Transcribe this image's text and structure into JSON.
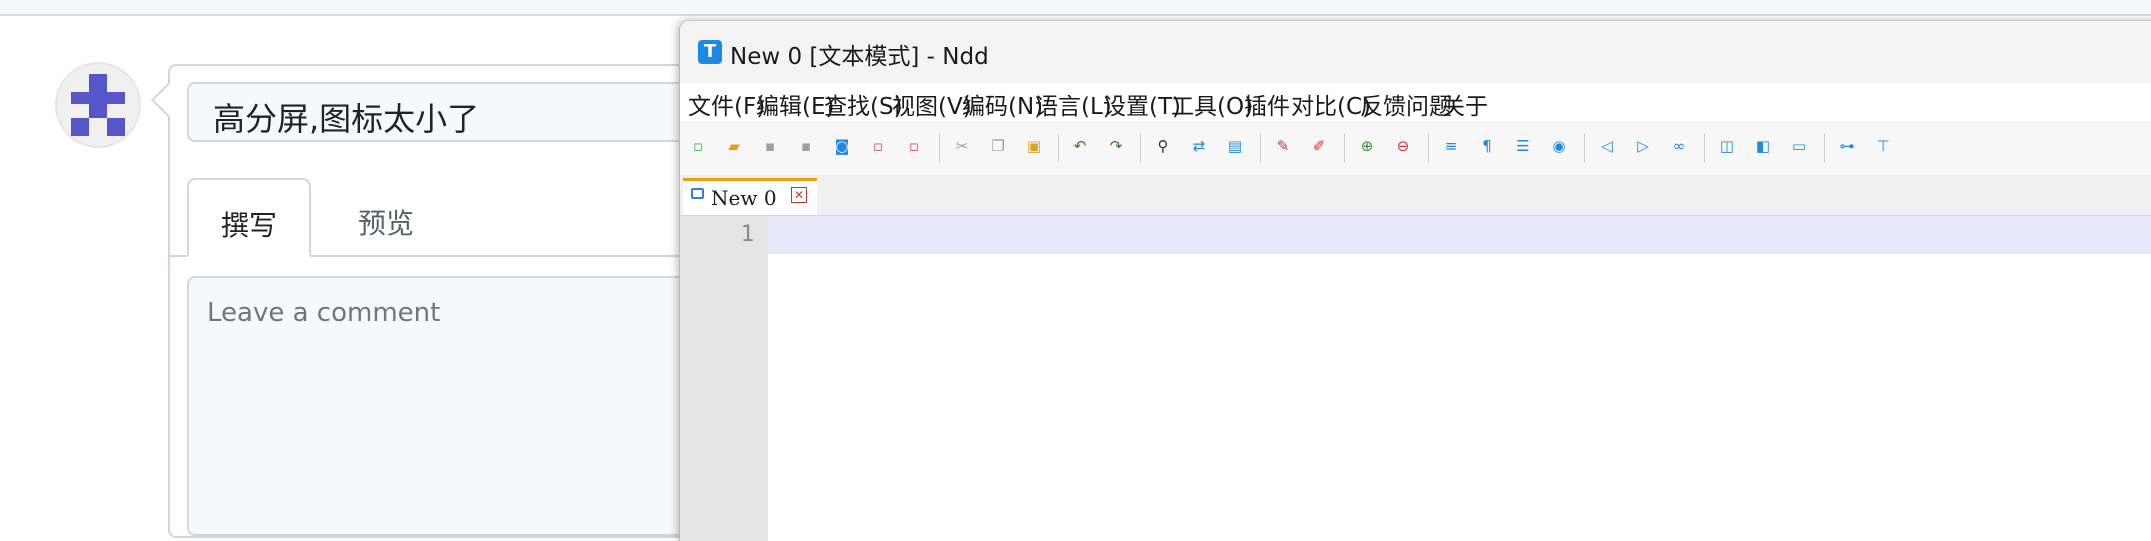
{
  "web": {
    "issue_title": "高分屏,图标太小了",
    "tabs": [
      {
        "label": "撰写"
      },
      {
        "label": "预览"
      }
    ],
    "comment_placeholder": "Leave a comment"
  },
  "editor_window": {
    "title": "New 0 [文本模式] - Ndd",
    "menu": [
      {
        "label": "文件(F)"
      },
      {
        "label": "编辑(E)"
      },
      {
        "label": "查找(S)"
      },
      {
        "label": "视图(V)"
      },
      {
        "label": "编码(N)"
      },
      {
        "label": "语言(L)"
      },
      {
        "label": "设置(T)"
      },
      {
        "label": "工具(O)"
      },
      {
        "label": "插件"
      },
      {
        "label": "对比(C)"
      },
      {
        "label": "反馈问题"
      },
      {
        "label": "关于"
      }
    ],
    "document_tab": {
      "label": "New 0"
    },
    "line_number": "1"
  },
  "colors": {
    "accent_blue": "#1e88e5",
    "tab_highlight": "#f39c12",
    "current_line": "#e8e8fa"
  }
}
